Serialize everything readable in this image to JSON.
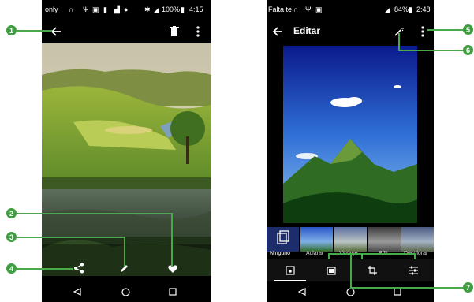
{
  "left_phone": {
    "status": {
      "left": "only",
      "right": "100%",
      "time": "4:15"
    },
    "callouts": [
      "1",
      "2",
      "3",
      "4"
    ]
  },
  "right_phone": {
    "status": {
      "left": "Falta te",
      "right": "84%",
      "time": "2:48"
    },
    "title": "Editar",
    "filters": [
      "Ninguno",
      "Aclarar",
      "Vintage",
      "B/N",
      "Decolorar"
    ],
    "tools": [
      "auto-fix-tool-icon",
      "photo-tool-icon",
      "crop-tool-icon",
      "adjust-tool-icon"
    ],
    "callouts": [
      "5",
      "6",
      "7"
    ]
  },
  "colors": {
    "callout": "#3e9e40",
    "background": "#000000",
    "accent": "#ffffff"
  }
}
